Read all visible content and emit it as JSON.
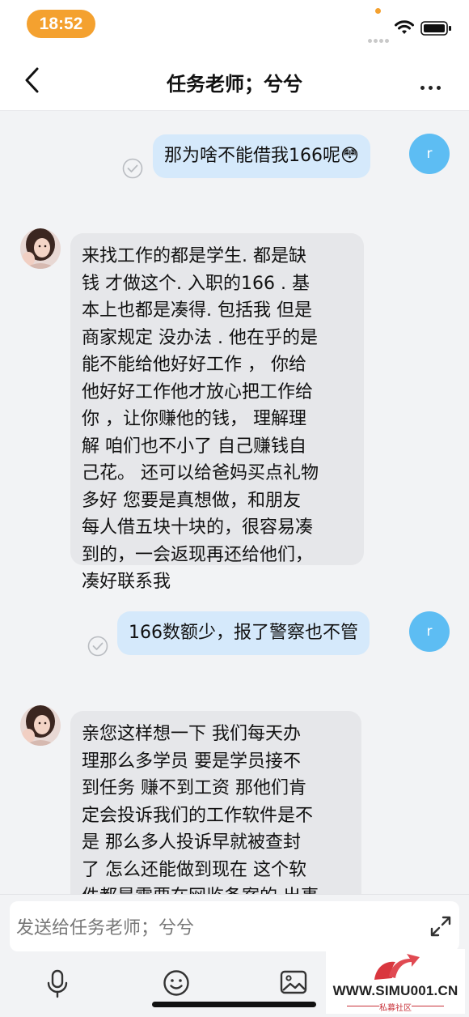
{
  "status_bar": {
    "time": "18:52"
  },
  "header": {
    "title": "任务老师；兮兮"
  },
  "messages": [
    {
      "side": "out",
      "avatar_letter": "r",
      "text": "那为啥不能借我166呢😳"
    },
    {
      "side": "in",
      "lines": [
        "来找工作的都是学生. 都是缺",
        "钱 才做这个. 入职的166 .   基",
        "本上也都是凑得. 包括我  但是",
        "商家规定 没办法 . 他在乎的是",
        "能不能给他好好工作 ，  你给",
        "他好好工作他才放心把工作给",
        "你 ，让你赚他的钱，  理解理",
        "解 咱们也不小了 自己赚钱自",
        "己花。 还可以给爸妈买点礼物",
        "多好    您要是真想做，和朋友",
        "每人借五块十块的，很容易凑",
        "到的，一会返现再还给他们，",
        "凑好联系我"
      ]
    },
    {
      "side": "out",
      "avatar_letter": "r",
      "text": "166数额少，报了警察也不管"
    },
    {
      "side": "in",
      "lines": [
        "亲您这样想一下  我们每天办",
        "理那么多学员   要是学员接不",
        "到任务 赚不到工资  那他们肯",
        "定会投诉我们的工作软件是不",
        "是   那么多人投诉早就被查封",
        "了 怎么还能做到现在   这个软",
        "件都是需要在网监备案的 出事"
      ]
    }
  ],
  "input": {
    "placeholder": "发送给任务老师；兮兮"
  },
  "toolbar": {
    "icons": [
      "microphone-icon",
      "emoji-icon",
      "image-icon"
    ]
  },
  "watermark": {
    "text": "WWW.SIMU001.CN",
    "sub": "私募社区"
  }
}
